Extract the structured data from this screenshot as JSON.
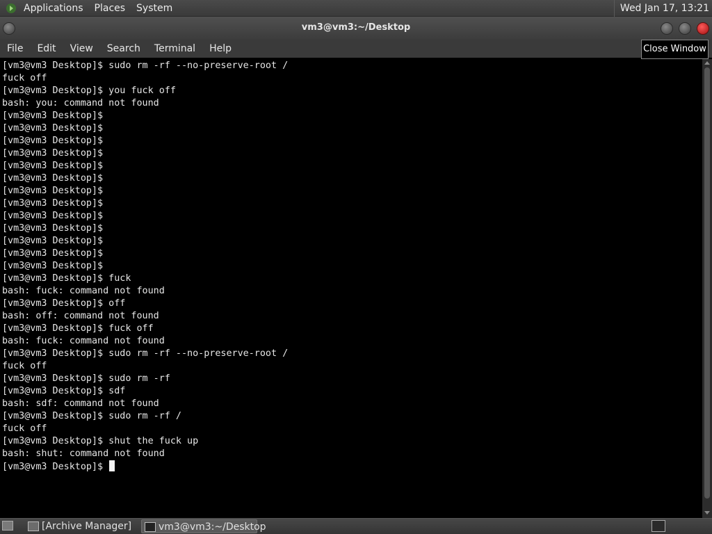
{
  "top_panel": {
    "menus": [
      "Applications",
      "Places",
      "System"
    ],
    "clock": "Wed Jan 17, 13:21"
  },
  "window": {
    "title": "vm3@vm3:~/Desktop",
    "menu": [
      "File",
      "Edit",
      "View",
      "Search",
      "Terminal",
      "Help"
    ],
    "tooltip": "Close Window"
  },
  "terminal": {
    "lines": [
      "[vm3@vm3 Desktop]$ sudo rm -rf --no-preserve-root /",
      "fuck off",
      "[vm3@vm3 Desktop]$ you fuck off",
      "bash: you: command not found",
      "[vm3@vm3 Desktop]$",
      "[vm3@vm3 Desktop]$",
      "[vm3@vm3 Desktop]$",
      "[vm3@vm3 Desktop]$",
      "[vm3@vm3 Desktop]$",
      "[vm3@vm3 Desktop]$",
      "[vm3@vm3 Desktop]$",
      "[vm3@vm3 Desktop]$",
      "[vm3@vm3 Desktop]$",
      "[vm3@vm3 Desktop]$",
      "[vm3@vm3 Desktop]$",
      "[vm3@vm3 Desktop]$",
      "[vm3@vm3 Desktop]$",
      "[vm3@vm3 Desktop]$ fuck",
      "bash: fuck: command not found",
      "[vm3@vm3 Desktop]$ off",
      "bash: off: command not found",
      "[vm3@vm3 Desktop]$ fuck off",
      "bash: fuck: command not found",
      "[vm3@vm3 Desktop]$ sudo rm -rf --no-preserve-root /",
      "fuck off",
      "[vm3@vm3 Desktop]$ sudo rm -rf",
      "[vm3@vm3 Desktop]$ sdf",
      "bash: sdf: command not found",
      "[vm3@vm3 Desktop]$ sudo rm -rf /",
      "fuck off",
      "[vm3@vm3 Desktop]$ shut the fuck up",
      "bash: shut: command not found"
    ],
    "prompt": "[vm3@vm3 Desktop]$ "
  },
  "taskbar": {
    "tasks": [
      "[Archive Manager]",
      "vm3@vm3:~/Desktop"
    ]
  }
}
